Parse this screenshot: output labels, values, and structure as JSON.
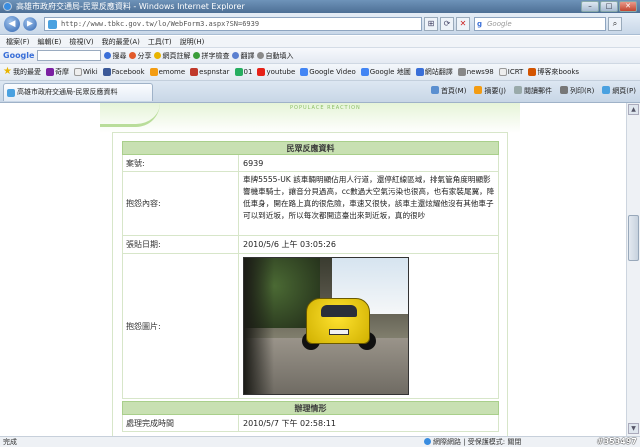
{
  "window": {
    "title": "高雄市政府交通局-民眾反應資料 - Windows Internet Explorer"
  },
  "address": {
    "url": "http://www.tbkc.gov.tw/lo/WebForm3.aspx?SN=6939",
    "search_placeholder": "Google",
    "search_logo": "g"
  },
  "menu": {
    "items": [
      "檔案(F)",
      "編輯(E)",
      "檢視(V)",
      "我的最愛(A)",
      "工具(T)",
      "說明(H)"
    ]
  },
  "googlebar": {
    "logo": "Google",
    "items": [
      "搜尋",
      "分享",
      "網頁註解",
      "拼字檢查",
      "翻譯",
      "自動填入"
    ]
  },
  "favorites": {
    "label": "我的最愛",
    "items": [
      "奇摩",
      "Wiki",
      "Facebook",
      "emome",
      "espnstar",
      "01",
      "youtube",
      "Google Video",
      "Google 地圖",
      "網站翻譯",
      "news98",
      "ICRT",
      "博客來books"
    ]
  },
  "tab": {
    "title": "高雄市政府交通局-民眾反應資料"
  },
  "commands": {
    "items": [
      "首頁(M)",
      "摘要(J)",
      "閱讀郵件",
      "列印(R)",
      "網頁(P)"
    ]
  },
  "banner": {
    "subtitle": "POPULACE REACTION"
  },
  "record": {
    "header": "民眾反應資料",
    "rows": [
      {
        "label": "案號:",
        "value": "6939"
      },
      {
        "label": "抱怨內容:",
        "value": "車牌5555-UK 該車輛明顯佔用人行道，還停紅線區域，排氣管角度明顯影響機車騎士，讓音分貝過高，cc數過大空氣污染也很高，也有家裝尾翼，降低車身，開在路上真的很危險，車速又很快，該車主還炫耀他沒有其他車子可以到近坂，所以每次都開這臺出來到近坂，真的很吵"
      },
      {
        "label": "張貼日期:",
        "value": "2010/5/6 上午 03:05:26"
      },
      {
        "label": "抱怨圖片:",
        "value": ""
      }
    ]
  },
  "handling": {
    "header": "辦理情形",
    "rows": [
      {
        "label": "處理完成時間",
        "value": "2010/5/7 下午 02:58:11"
      }
    ]
  },
  "status": {
    "text": "完成",
    "zone": "網際網路 | 受保護模式: 關閉",
    "watermark": "#353497"
  },
  "colors": {
    "header_green": "#c8e0b2",
    "border_green": "#d7e6c9"
  }
}
